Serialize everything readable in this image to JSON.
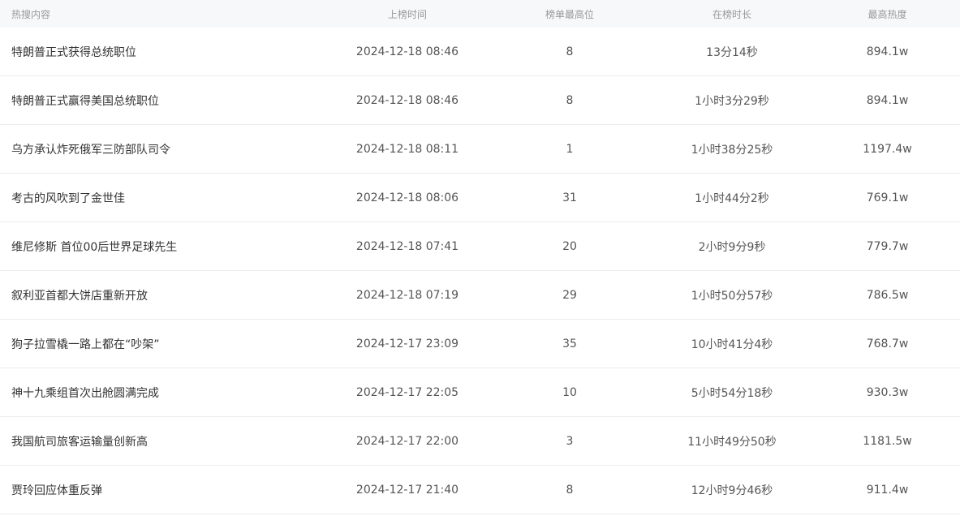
{
  "table": {
    "headers": {
      "title": "热搜内容",
      "time": "上榜时间",
      "rank": "榜单最高位",
      "duration": "在榜时长",
      "heat": "最高热度"
    },
    "rows": [
      {
        "title": "特朗普正式获得总统职位",
        "time": "2024-12-18 08:46",
        "rank": "8",
        "duration": "13分14秒",
        "heat": "894.1w"
      },
      {
        "title": "特朗普正式赢得美国总统职位",
        "time": "2024-12-18 08:46",
        "rank": "8",
        "duration": "1小时3分29秒",
        "heat": "894.1w"
      },
      {
        "title": "乌方承认炸死俄军三防部队司令",
        "time": "2024-12-18 08:11",
        "rank": "1",
        "duration": "1小时38分25秒",
        "heat": "1197.4w"
      },
      {
        "title": "考古的风吹到了金世佳",
        "time": "2024-12-18 08:06",
        "rank": "31",
        "duration": "1小时44分2秒",
        "heat": "769.1w"
      },
      {
        "title": "维尼修斯 首位00后世界足球先生",
        "time": "2024-12-18 07:41",
        "rank": "20",
        "duration": "2小时9分9秒",
        "heat": "779.7w"
      },
      {
        "title": "叙利亚首都大饼店重新开放",
        "time": "2024-12-18 07:19",
        "rank": "29",
        "duration": "1小时50分57秒",
        "heat": "786.5w"
      },
      {
        "title": "狗子拉雪橇一路上都在“吵架”",
        "time": "2024-12-17 23:09",
        "rank": "35",
        "duration": "10小时41分4秒",
        "heat": "768.7w"
      },
      {
        "title": "神十九乘组首次出舱圆满完成",
        "time": "2024-12-17 22:05",
        "rank": "10",
        "duration": "5小时54分18秒",
        "heat": "930.3w"
      },
      {
        "title": "我国航司旅客运输量创新高",
        "time": "2024-12-17 22:00",
        "rank": "3",
        "duration": "11小时49分50秒",
        "heat": "1181.5w"
      },
      {
        "title": "贾玲回应体重反弹",
        "time": "2024-12-17 21:40",
        "rank": "8",
        "duration": "12小时9分46秒",
        "heat": "911.4w"
      }
    ]
  }
}
